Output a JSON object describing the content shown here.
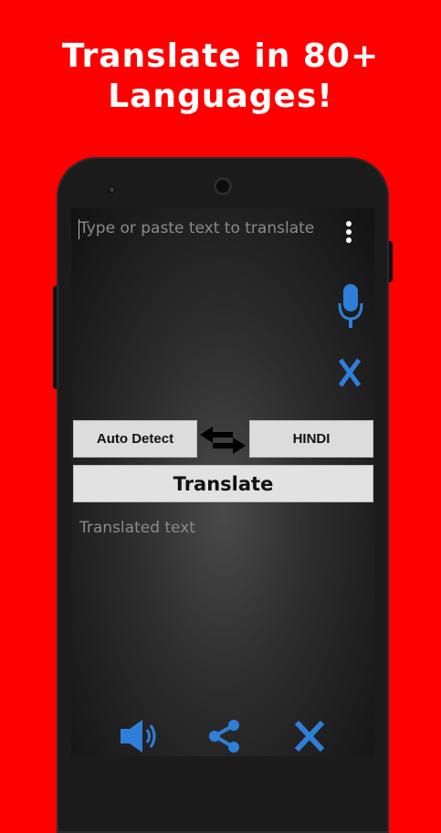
{
  "headline": {
    "line1": "Translate in 80+",
    "line2": "Languages!"
  },
  "app": {
    "input": {
      "placeholder": "Type or paste text to translate"
    },
    "menu_icon": "more-vert-icon",
    "mic_icon": "microphone-icon",
    "clear_icon": "close-icon",
    "source_language": "Auto Detect",
    "swap_icon": "swap-arrows-icon",
    "target_language": "HINDI",
    "translate_label": "Translate",
    "output": {
      "placeholder": "Translated text"
    },
    "bottom_bar": {
      "speak_icon": "speaker-icon",
      "share_icon": "share-icon",
      "clear_icon": "close-icon"
    },
    "colors": {
      "accent": "#2f7fd8",
      "background": "#ff0000"
    }
  }
}
